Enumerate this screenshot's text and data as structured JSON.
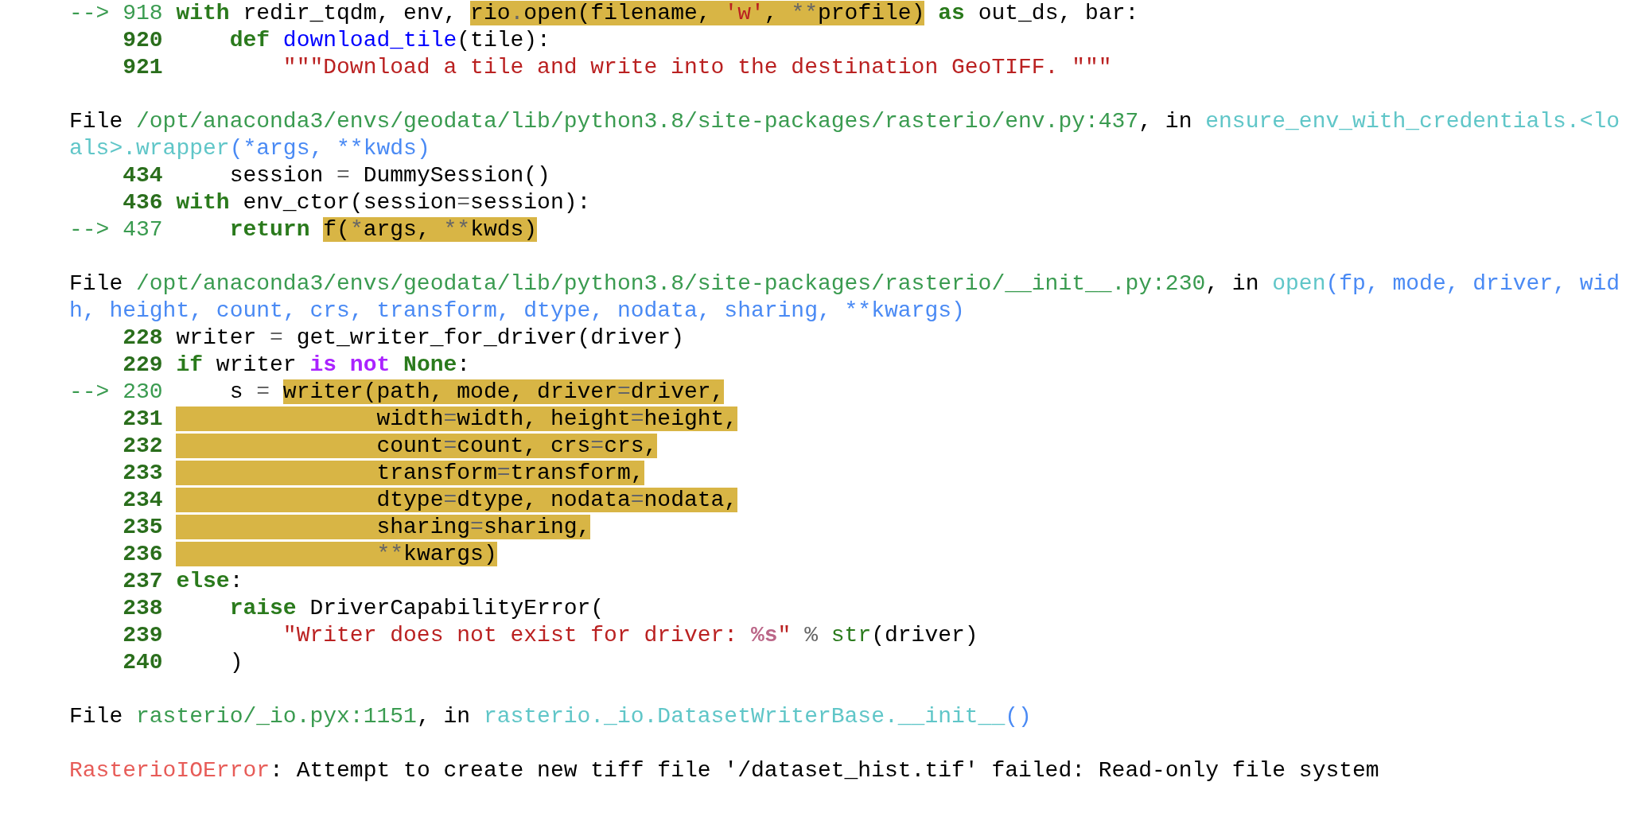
{
  "frames": [
    {
      "lines": [
        {
          "number": "918",
          "marker": "-->",
          "current": true,
          "tokens": [
            {
              "text": "with",
              "kind": "keyword",
              "highlighted": false
            },
            {
              "text": " redir_tqdm, env, ",
              "kind": "text",
              "highlighted": false
            },
            {
              "text": "rio",
              "kind": "text",
              "highlighted": true
            },
            {
              "text": ".",
              "kind": "operator",
              "highlighted": true
            },
            {
              "text": "open(filename, ",
              "kind": "text",
              "highlighted": true
            },
            {
              "text": "'w'",
              "kind": "string",
              "highlighted": true
            },
            {
              "text": ", ",
              "kind": "text",
              "highlighted": true
            },
            {
              "text": "**",
              "kind": "operator",
              "highlighted": true
            },
            {
              "text": "profile)",
              "kind": "text",
              "highlighted": true
            },
            {
              "text": " as",
              "kind": "keyword",
              "highlighted": false
            },
            {
              "text": " out_ds, bar:",
              "kind": "text",
              "highlighted": false
            }
          ]
        },
        {
          "number": "920",
          "current": false,
          "tokens": [
            {
              "text": "    def",
              "kind": "keyword",
              "highlighted": false
            },
            {
              "text": " download_tile",
              "kind": "def_name",
              "highlighted": false
            },
            {
              "text": "(tile):",
              "kind": "text",
              "highlighted": false
            }
          ]
        },
        {
          "number": "921",
          "current": false,
          "tokens": [
            {
              "text": "        \"\"\"Download a tile and write into the destination GeoTIFF. \"\"\"",
              "kind": "string",
              "highlighted": false
            }
          ]
        }
      ]
    },
    {
      "header": [
        [
          {
            "text": "File ",
            "kind": "text",
            "highlighted": false
          },
          {
            "text": "/opt/anaconda3/envs/geodata/lib/python3.8/site-packages/rasterio/env.py:437",
            "kind": "path",
            "highlighted": false
          },
          {
            "text": ", in ",
            "kind": "text",
            "highlighted": false
          },
          {
            "text": "ensure_env_with_credentials.<lo",
            "kind": "function",
            "highlighted": false
          }
        ],
        [
          {
            "text": "als>.wrapper",
            "kind": "function",
            "highlighted": false
          },
          {
            "text": "(*args, **kwds)",
            "kind": "args",
            "highlighted": false
          }
        ]
      ],
      "lines": [
        {
          "number": "434",
          "current": false,
          "tokens": [
            {
              "text": "    session ",
              "kind": "text",
              "highlighted": false
            },
            {
              "text": "=",
              "kind": "operator",
              "highlighted": false
            },
            {
              "text": " DummySession()",
              "kind": "text",
              "highlighted": false
            }
          ]
        },
        {
          "number": "436",
          "current": false,
          "tokens": [
            {
              "text": "with",
              "kind": "keyword",
              "highlighted": false
            },
            {
              "text": " env_ctor(session",
              "kind": "text",
              "highlighted": false
            },
            {
              "text": "=",
              "kind": "operator",
              "highlighted": false
            },
            {
              "text": "session):",
              "kind": "text",
              "highlighted": false
            }
          ]
        },
        {
          "number": "437",
          "marker": "-->",
          "current": true,
          "tokens": [
            {
              "text": "    return ",
              "kind": "keyword",
              "highlighted": false
            },
            {
              "text": "f(",
              "kind": "text",
              "highlighted": true
            },
            {
              "text": "*",
              "kind": "operator",
              "highlighted": true
            },
            {
              "text": "args, ",
              "kind": "text",
              "highlighted": true
            },
            {
              "text": "**",
              "kind": "operator",
              "highlighted": true
            },
            {
              "text": "kwds)",
              "kind": "text",
              "highlighted": true
            }
          ]
        }
      ]
    },
    {
      "header": [
        [
          {
            "text": "File ",
            "kind": "text",
            "highlighted": false
          },
          {
            "text": "/opt/anaconda3/envs/geodata/lib/python3.8/site-packages/rasterio/__init__.py:230",
            "kind": "path",
            "highlighted": false
          },
          {
            "text": ", in ",
            "kind": "text",
            "highlighted": false
          },
          {
            "text": "open",
            "kind": "function",
            "highlighted": false
          },
          {
            "text": "(fp, mode, driver, wid",
            "kind": "args",
            "highlighted": false
          }
        ],
        [
          {
            "text": "h, height, count, crs, transform, dtype, nodata, sharing, **kwargs)",
            "kind": "args",
            "highlighted": false
          }
        ]
      ],
      "lines": [
        {
          "number": "228",
          "current": false,
          "tokens": [
            {
              "text": "writer ",
              "kind": "text",
              "highlighted": false
            },
            {
              "text": "=",
              "kind": "operator",
              "highlighted": false
            },
            {
              "text": " get_writer_for_driver(driver)",
              "kind": "text",
              "highlighted": false
            }
          ]
        },
        {
          "number": "229",
          "current": false,
          "tokens": [
            {
              "text": "if",
              "kind": "keyword",
              "highlighted": false
            },
            {
              "text": " writer ",
              "kind": "text",
              "highlighted": false
            },
            {
              "text": "is",
              "kind": "operator_word",
              "highlighted": false
            },
            {
              "text": " not",
              "kind": "operator_word",
              "highlighted": false
            },
            {
              "text": " None",
              "kind": "keyword",
              "highlighted": false
            },
            {
              "text": ":",
              "kind": "text",
              "highlighted": false
            }
          ]
        },
        {
          "number": "230",
          "marker": "-->",
          "current": true,
          "tokens": [
            {
              "text": "    s ",
              "kind": "text",
              "highlighted": false
            },
            {
              "text": "= ",
              "kind": "operator",
              "highlighted": false
            },
            {
              "text": "writer(path, mode, driver",
              "kind": "text",
              "highlighted": true
            },
            {
              "text": "=",
              "kind": "operator",
              "highlighted": true
            },
            {
              "text": "driver,",
              "kind": "text",
              "highlighted": true
            }
          ]
        },
        {
          "number": "231",
          "current": false,
          "tokens": [
            {
              "text": "               width",
              "kind": "text",
              "highlighted": true
            },
            {
              "text": "=",
              "kind": "operator",
              "highlighted": true
            },
            {
              "text": "width, height",
              "kind": "text",
              "highlighted": true
            },
            {
              "text": "=",
              "kind": "operator",
              "highlighted": true
            },
            {
              "text": "height,",
              "kind": "text",
              "highlighted": true
            }
          ]
        },
        {
          "number": "232",
          "current": false,
          "tokens": [
            {
              "text": "               count",
              "kind": "text",
              "highlighted": true
            },
            {
              "text": "=",
              "kind": "operator",
              "highlighted": true
            },
            {
              "text": "count, crs",
              "kind": "text",
              "highlighted": true
            },
            {
              "text": "=",
              "kind": "operator",
              "highlighted": true
            },
            {
              "text": "crs,",
              "kind": "text",
              "highlighted": true
            }
          ]
        },
        {
          "number": "233",
          "current": false,
          "tokens": [
            {
              "text": "               transform",
              "kind": "text",
              "highlighted": true
            },
            {
              "text": "=",
              "kind": "operator",
              "highlighted": true
            },
            {
              "text": "transform,",
              "kind": "text",
              "highlighted": true
            }
          ]
        },
        {
          "number": "234",
          "current": false,
          "tokens": [
            {
              "text": "               dtype",
              "kind": "text",
              "highlighted": true
            },
            {
              "text": "=",
              "kind": "operator",
              "highlighted": true
            },
            {
              "text": "dtype, nodata",
              "kind": "text",
              "highlighted": true
            },
            {
              "text": "=",
              "kind": "operator",
              "highlighted": true
            },
            {
              "text": "nodata,",
              "kind": "text",
              "highlighted": true
            }
          ]
        },
        {
          "number": "235",
          "current": false,
          "tokens": [
            {
              "text": "               sharing",
              "kind": "text",
              "highlighted": true
            },
            {
              "text": "=",
              "kind": "operator",
              "highlighted": true
            },
            {
              "text": "sharing,",
              "kind": "text",
              "highlighted": true
            }
          ]
        },
        {
          "number": "236",
          "current": false,
          "tokens": [
            {
              "text": "               **",
              "kind": "operator",
              "highlighted": true
            },
            {
              "text": "kwargs)",
              "kind": "text",
              "highlighted": true
            }
          ]
        },
        {
          "number": "237",
          "current": false,
          "tokens": [
            {
              "text": "else",
              "kind": "keyword",
              "highlighted": false
            },
            {
              "text": ":",
              "kind": "text",
              "highlighted": false
            }
          ]
        },
        {
          "number": "238",
          "current": false,
          "tokens": [
            {
              "text": "    raise",
              "kind": "keyword",
              "highlighted": false
            },
            {
              "text": " DriverCapabilityError(",
              "kind": "text",
              "highlighted": false
            }
          ]
        },
        {
          "number": "239",
          "current": false,
          "tokens": [
            {
              "text": "        \"Writer does not exist for driver: ",
              "kind": "string",
              "highlighted": false
            },
            {
              "text": "%s",
              "kind": "format",
              "highlighted": false
            },
            {
              "text": "\" ",
              "kind": "string",
              "highlighted": false
            },
            {
              "text": "% ",
              "kind": "operator",
              "highlighted": false
            },
            {
              "text": "str",
              "kind": "builtin",
              "highlighted": false
            },
            {
              "text": "(driver)",
              "kind": "text",
              "highlighted": false
            }
          ]
        },
        {
          "number": "240",
          "current": false,
          "tokens": [
            {
              "text": "    )",
              "kind": "text",
              "highlighted": false
            }
          ]
        }
      ]
    },
    {
      "header": [
        [
          {
            "text": "File ",
            "kind": "text",
            "highlighted": false
          },
          {
            "text": "rasterio/_io.pyx:1151",
            "kind": "path",
            "highlighted": false
          },
          {
            "text": ", in ",
            "kind": "text",
            "highlighted": false
          },
          {
            "text": "rasterio._io.DatasetWriterBase.__init__",
            "kind": "function",
            "highlighted": false
          },
          {
            "text": "()",
            "kind": "args",
            "highlighted": false
          }
        ]
      ]
    }
  ],
  "error": [
    {
      "text": "RasterioIOError",
      "kind": "error_name",
      "highlighted": false
    },
    {
      "text": ": Attempt to create new tiff file '/dataset_hist.tif' failed: Read-only file system",
      "kind": "text",
      "highlighted": false
    }
  ]
}
